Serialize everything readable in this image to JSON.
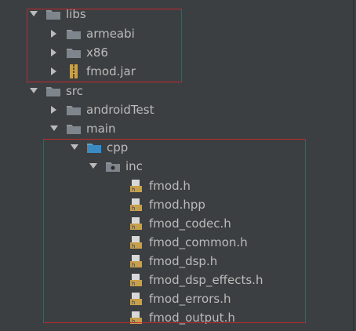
{
  "colors": {
    "background": "#3c3f41",
    "text": "#bbbbbb",
    "folder": "#7e858c",
    "folder_blue": "#3b8bc2",
    "header_file": "#c9a04a",
    "annotation": "#c0282f"
  },
  "tree": {
    "libs": {
      "label": "libs",
      "icon": "folder-icon",
      "expanded": true
    },
    "armeabi": {
      "label": "armeabi",
      "icon": "folder-icon",
      "expanded": false
    },
    "x86": {
      "label": "x86",
      "icon": "folder-icon",
      "expanded": false
    },
    "fmod_jar": {
      "label": "fmod.jar",
      "icon": "jar-icon",
      "expanded": false
    },
    "src": {
      "label": "src",
      "icon": "folder-icon",
      "expanded": true
    },
    "androidTest": {
      "label": "androidTest",
      "icon": "folder-icon",
      "expanded": false
    },
    "main": {
      "label": "main",
      "icon": "folder-icon",
      "expanded": true
    },
    "cpp": {
      "label": "cpp",
      "icon": "source-folder-icon",
      "expanded": true
    },
    "inc": {
      "label": "inc",
      "icon": "package-folder-icon",
      "expanded": true
    },
    "files": [
      {
        "label": "fmod.h",
        "icon": "header-file-icon"
      },
      {
        "label": "fmod.hpp",
        "icon": "header-file-icon"
      },
      {
        "label": "fmod_codec.h",
        "icon": "header-file-icon"
      },
      {
        "label": "fmod_common.h",
        "icon": "header-file-icon"
      },
      {
        "label": "fmod_dsp.h",
        "icon": "header-file-icon"
      },
      {
        "label": "fmod_dsp_effects.h",
        "icon": "header-file-icon"
      },
      {
        "label": "fmod_errors.h",
        "icon": "header-file-icon"
      },
      {
        "label": "fmod_output.h",
        "icon": "header-file-icon"
      }
    ]
  }
}
